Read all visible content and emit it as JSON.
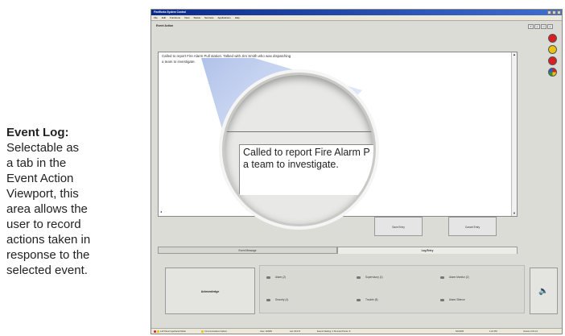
{
  "caption": {
    "title": "Event Log:",
    "lines": [
      "Selectable as",
      "a tab in the",
      "Event Action",
      "Viewport, this",
      "area allows the",
      "user to record",
      "actions taken in",
      "response to the",
      "selected event."
    ]
  },
  "window": {
    "title": "FireWorks System Control",
    "menu": [
      "File",
      "Edit",
      "Functions",
      "View",
      "Status",
      "Services",
      "Applications",
      "Help"
    ]
  },
  "panel": {
    "title": "Event Action"
  },
  "event_log": {
    "text_line1": "Called to report Fire Alarm Pull station. Talked with Jim Smith who was dispatching",
    "text_line2": "a team to investigate.",
    "magnified_line1": "Called to report Fire Alarm P",
    "magnified_line2": "a team to investigate."
  },
  "buttons": {
    "save": "Save Entry",
    "cancel": "Cancel Entry",
    "acknowledge": "Acknowledge"
  },
  "tabs": [
    "Event Message",
    "Log Entry"
  ],
  "status_items": [
    "Alarm (2)",
    "Supervisory (1)",
    "Alarm Monitor (2)",
    "Security (4)",
    "Trouble (8)",
    "Alarm Silence"
  ],
  "statusbar": {
    "left": "Loff Panel Ingerfaced Mode",
    "comm": "Communications Failure",
    "user": "User: ADMIN",
    "list": "List: 8C172",
    "events": "Events Waiting: 4   Shunted Points: 8",
    "date": "5/6/2005",
    "time": "1:22 PM",
    "version": "Version 2.01.10"
  },
  "colors": {
    "title_bar": "#0a2a8a",
    "led_red": "#d92020",
    "led_yellow": "#e9c212",
    "led_green": "#2c9a2c"
  }
}
